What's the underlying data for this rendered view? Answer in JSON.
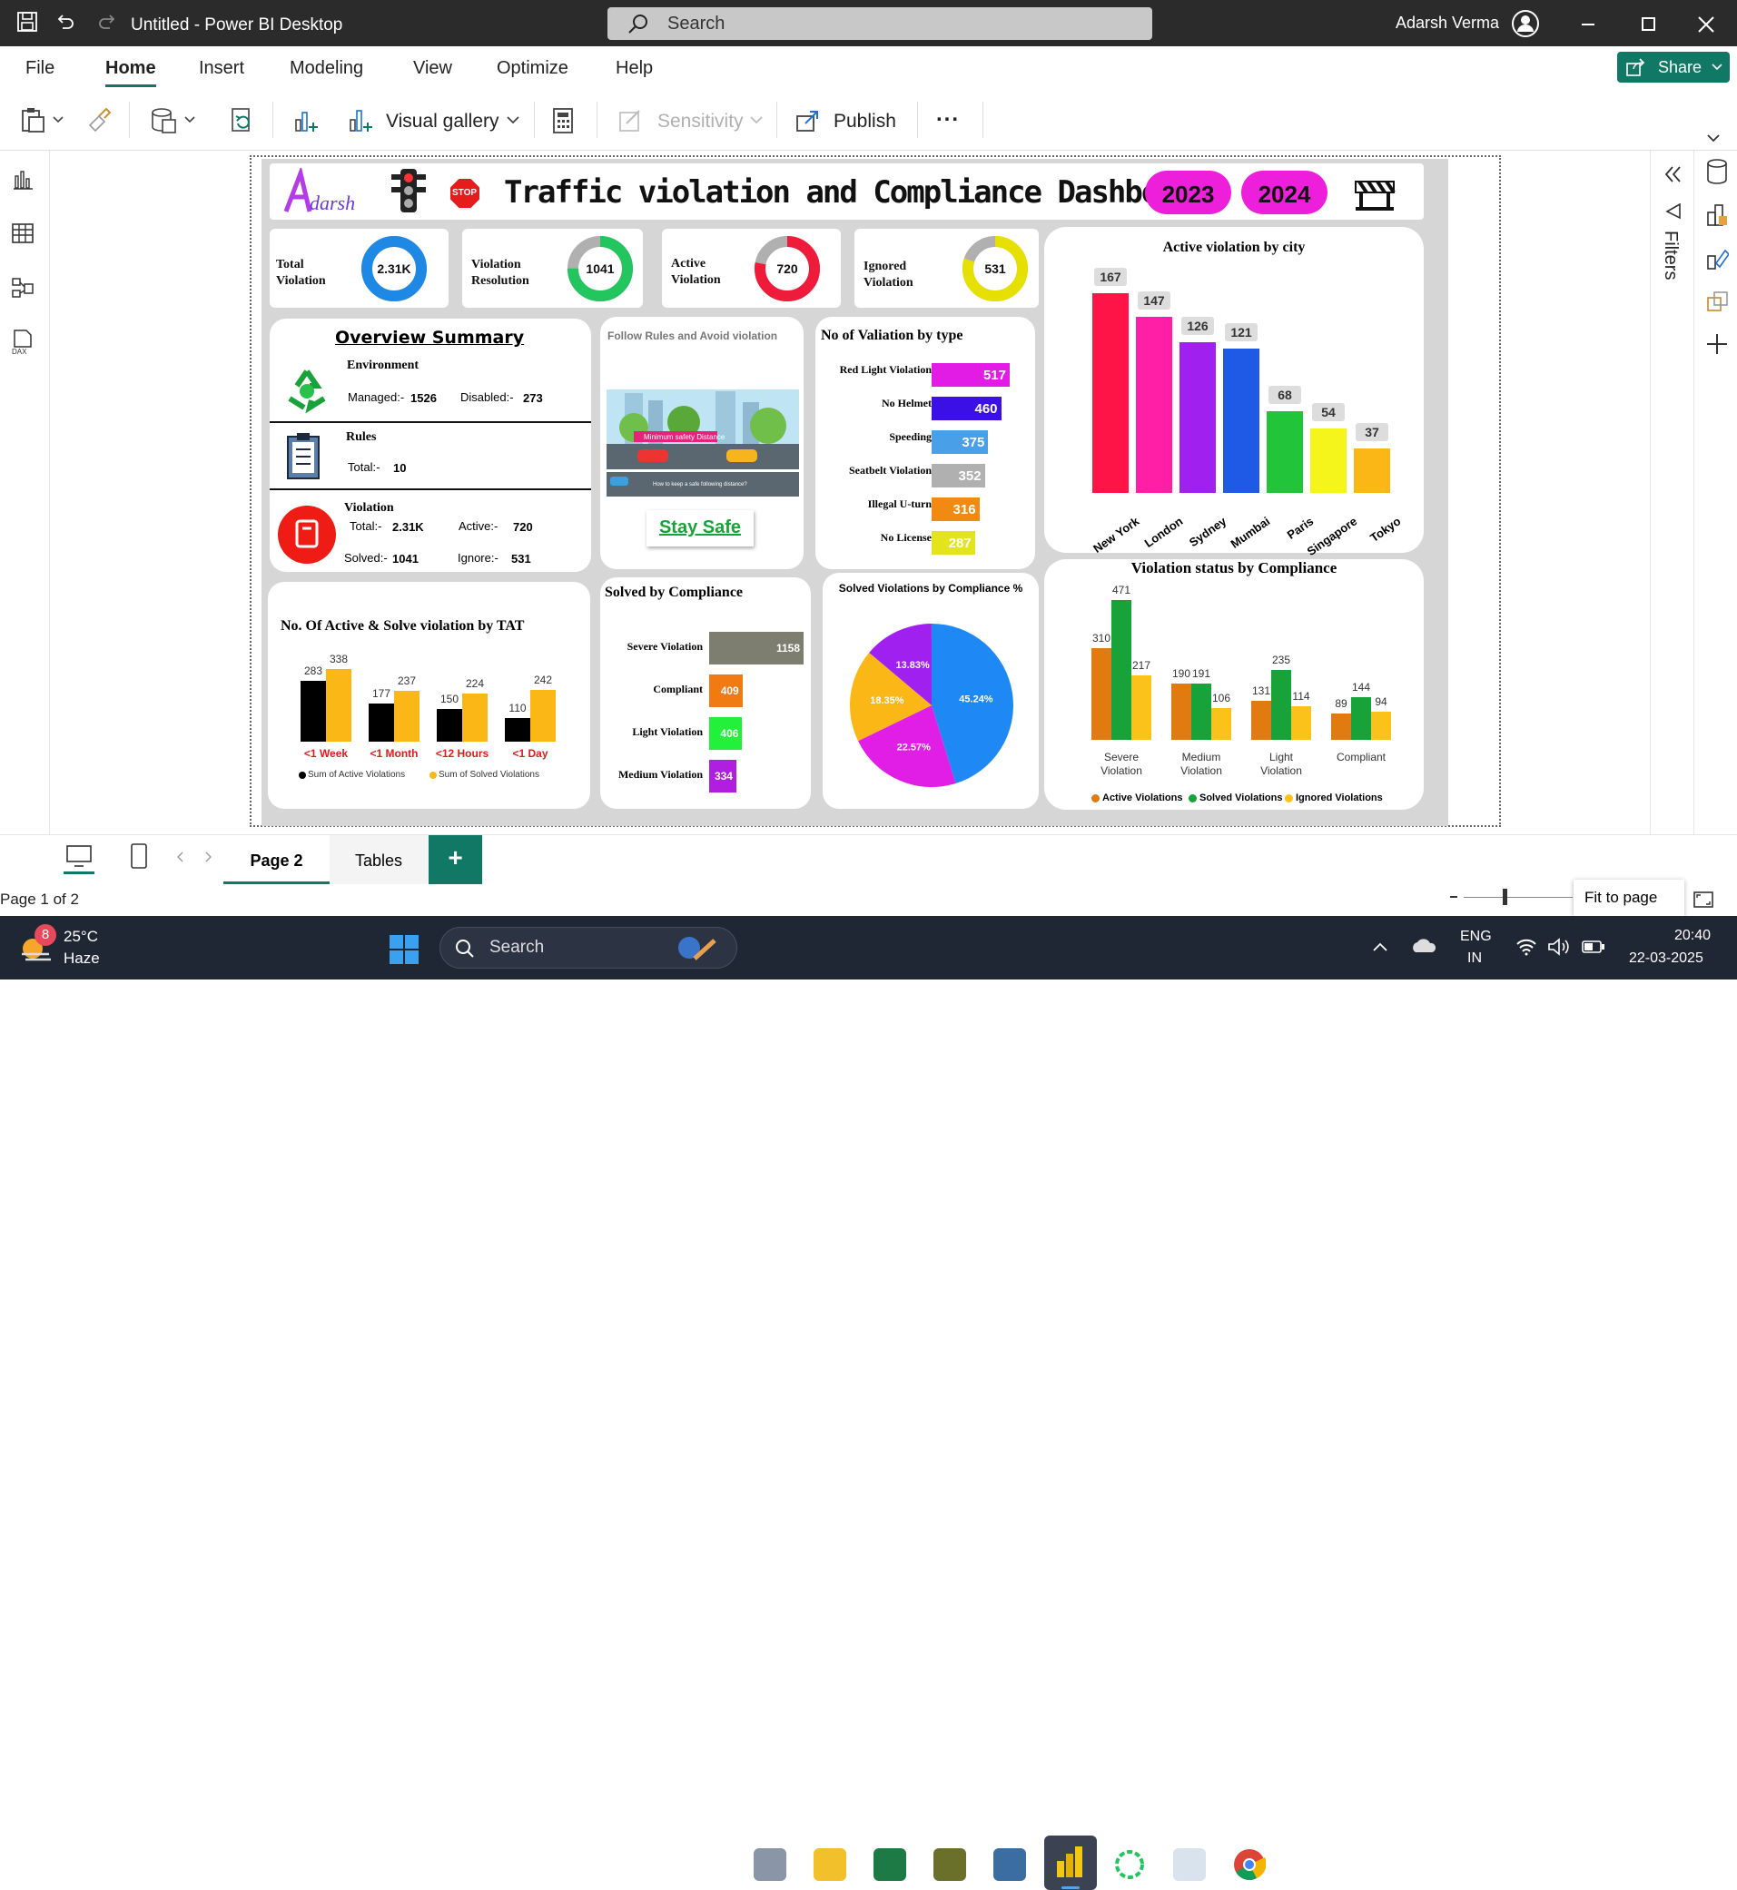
{
  "titlebar": {
    "title": "Untitled - Power BI Desktop",
    "search_placeholder": "Search",
    "user": "Adarsh Verma"
  },
  "menu": [
    "File",
    "Home",
    "Insert",
    "Modeling",
    "View",
    "Optimize",
    "Help"
  ],
  "share_label": "Share",
  "ribbon": {
    "visual_gallery": "Visual gallery",
    "sensitivity": "Sensitivity",
    "publish": "Publish",
    "more": "..."
  },
  "filters_label": "Filters",
  "dashboard": {
    "title": "Traffic violation and Compliance Dashboard",
    "logo_text": "Adarsh",
    "stop_text": "STOP",
    "years": [
      "2023",
      "2024"
    ],
    "kpis": [
      {
        "label1": "Total",
        "label2": "Violation",
        "value": "2.31K",
        "color": "#1e88e5",
        "fraction": 1.0
      },
      {
        "label1": "Violation",
        "label2": "Resolution",
        "value": "1041",
        "color": "#22c55e",
        "fraction": 0.75
      },
      {
        "label1": "Active",
        "label2": "Violation",
        "value": "720",
        "color": "#ef1b3b",
        "fraction": 0.78
      },
      {
        "label1": "Ignored",
        "label2": "Violation",
        "value": "531",
        "color": "#e6e000",
        "fraction": 0.8
      }
    ],
    "overview": {
      "title": "Overview Summary",
      "env_title": "Environment",
      "env_managed": "Managed:-",
      "env_managed_val": "1526",
      "env_disabled": "Disabled:-",
      "env_disabled_val": "273",
      "rules_title": "Rules",
      "rules_total": "Total:-",
      "rules_total_val": "10",
      "viol_title": "Violation",
      "viol_total": "Total:-",
      "viol_total_val": "2.31K",
      "viol_active": "Active:-",
      "viol_active_val": "720",
      "viol_solved": "Solved:-",
      "viol_solved_val": "1041",
      "viol_ignore": "Ignore:-",
      "viol_ignore_val": "531"
    },
    "follow": {
      "title": "Follow Rules and Avoid violation",
      "img_caption": "Minimum safety Distance",
      "img_sub": "How to keep a safe following distance?",
      "stay_safe": "Stay Safe"
    }
  },
  "chart_data": [
    {
      "id": "type",
      "type": "bar",
      "title": "No of Valiation by type",
      "categories": [
        "Red Light Violation",
        "No Helmet",
        "Speeding",
        "Seatbelt Violation",
        "Illegal U-turn",
        "No License"
      ],
      "values": [
        517,
        460,
        375,
        352,
        316,
        287
      ],
      "colors": [
        "#e21ce4",
        "#3a10e6",
        "#4aa0e8",
        "#b0b0b0",
        "#f28a12",
        "#e4e41c"
      ]
    },
    {
      "id": "city",
      "type": "bar",
      "title": "Active violation by city",
      "categories": [
        "New York",
        "London",
        "Sydney",
        "Mumbai",
        "Paris",
        "Singapore",
        "Tokyo"
      ],
      "values": [
        167,
        147,
        126,
        121,
        68,
        54,
        37
      ],
      "colors": [
        "#ff1447",
        "#ff1fa6",
        "#a020f0",
        "#1e5ae6",
        "#22c53a",
        "#f5f51c",
        "#fbb716"
      ]
    },
    {
      "id": "tat",
      "type": "bar",
      "title": "No. Of Active & Solve violation by  TAT",
      "categories": [
        "<1 Week",
        "<1 Month",
        "<12 Hours",
        "<1 Day"
      ],
      "series": [
        {
          "name": "Sum of Active Violations",
          "values": [
            283,
            177,
            150,
            110
          ],
          "color": "#000000"
        },
        {
          "name": "Sum of Solved Violations",
          "values": [
            338,
            237,
            224,
            242
          ],
          "color": "#fbb716"
        }
      ]
    },
    {
      "id": "solved",
      "type": "bar",
      "title": "Solved by Compliance",
      "categories": [
        "Severe Violation",
        "Compliant",
        "Light Violation",
        "Medium Violation"
      ],
      "values": [
        1158,
        409,
        406,
        334
      ],
      "colors": [
        "#7d7d70",
        "#f27a12",
        "#22f03a",
        "#b01ee0"
      ]
    },
    {
      "id": "pie",
      "type": "pie",
      "title": "Solved Violations by Compliance %",
      "slices": [
        {
          "label": "45.24%",
          "value": 45.24,
          "color": "#1e88f5"
        },
        {
          "label": "22.57%",
          "value": 22.57,
          "color": "#e01ee6"
        },
        {
          "label": "18.35%",
          "value": 18.35,
          "color": "#fbb716"
        },
        {
          "label": "13.83%",
          "value": 13.83,
          "color": "#a020f0"
        }
      ]
    },
    {
      "id": "status",
      "type": "bar",
      "title": "Violation status by Compliance",
      "categories": [
        "Severe Violation",
        "Medium Violation",
        "Light Violation",
        "Compliant"
      ],
      "category_lines": [
        [
          "Severe",
          "Violation"
        ],
        [
          "Medium",
          "Violation"
        ],
        [
          "Light",
          "Violation"
        ],
        [
          "Compliant"
        ]
      ],
      "series": [
        {
          "name": "Active Violations",
          "values": [
            310,
            190,
            131,
            89
          ],
          "color": "#e07b12"
        },
        {
          "name": "Solved Violations",
          "values": [
            471,
            191,
            235,
            144
          ],
          "color": "#18a33a"
        },
        {
          "name": "Ignored Violations",
          "values": [
            217,
            106,
            114,
            94
          ],
          "color": "#fbc21c"
        }
      ]
    }
  ],
  "pagetabs": {
    "tabs": [
      "Page 2",
      "Tables"
    ],
    "add": "+"
  },
  "status": {
    "page": "Page 1 of 2",
    "fit": "Fit to page"
  },
  "taskbar": {
    "temp": "25°C",
    "weather": "Haze",
    "badge": "8",
    "search": "Search",
    "lang1": "ENG",
    "lang2": "IN",
    "time": "20:40",
    "date": "22-03-2025"
  }
}
